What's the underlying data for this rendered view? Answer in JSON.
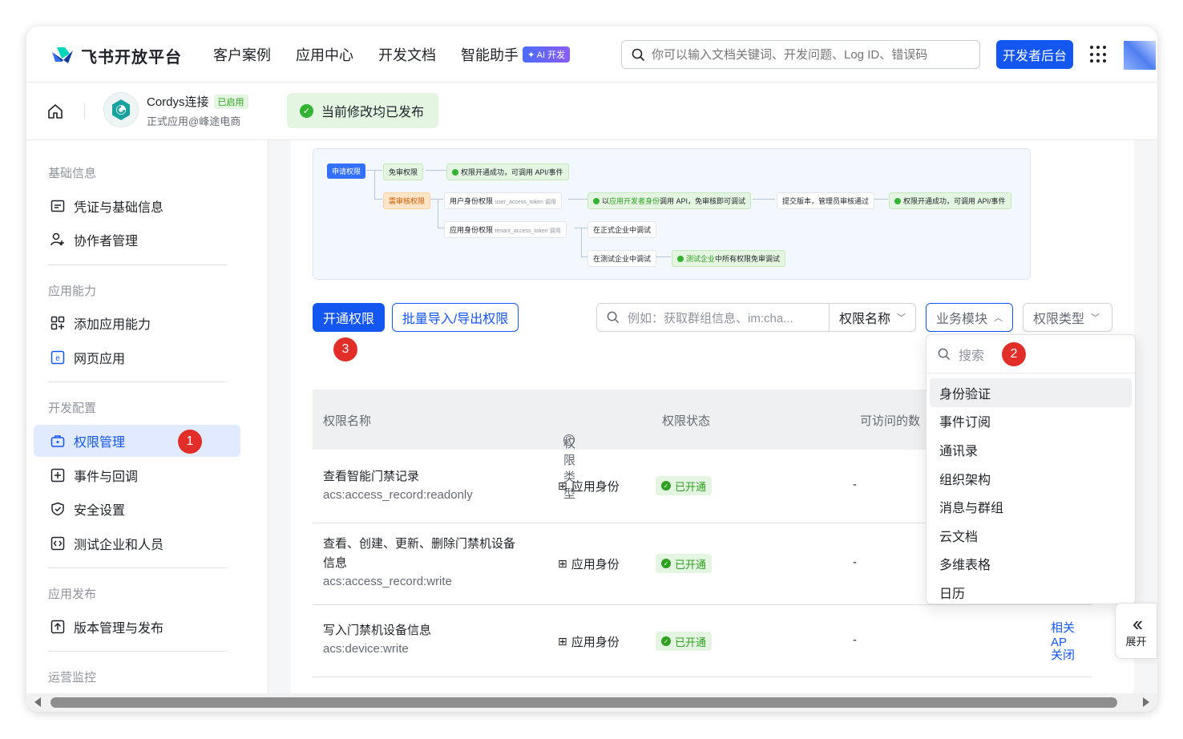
{
  "topnav": {
    "logo_text": "飞书开放平台",
    "links": [
      "客户案例",
      "应用中心",
      "开发文档",
      "智能助手"
    ],
    "ai_badge": "✦ AI 开发",
    "search_placeholder": "你可以输入文档关键词、开发问题、Log ID、错误码",
    "dev_button": "开发者后台"
  },
  "appbar": {
    "app_name": "Cordys连接",
    "app_status": "已启用",
    "app_subtitle": "正式应用@峰途电商",
    "published_notice": "当前修改均已发布"
  },
  "sidebar": {
    "sections": [
      {
        "title": "基础信息",
        "items": [
          "凭证与基础信息",
          "协作者管理"
        ]
      },
      {
        "title": "应用能力",
        "items": [
          "添加应用能力",
          "网页应用"
        ]
      },
      {
        "title": "开发配置",
        "items": [
          "权限管理",
          "事件与回调",
          "安全设置",
          "测试企业和人员"
        ]
      },
      {
        "title": "应用发布",
        "items": [
          "版本管理与发布"
        ]
      },
      {
        "title": "运营监控",
        "items": []
      }
    ],
    "active_item": "权限管理",
    "badge_1": "1"
  },
  "flow": {
    "apply": "申请权限",
    "no_review": "免审权限",
    "success1": "权限开通成功，可调用 API/事件",
    "need_review": "需审核权限",
    "user_perm": "用户身份权限",
    "user_token": "user_access_token 调用",
    "dev_call_prefix": "以",
    "dev_call_highlight": "应用开发者身份",
    "dev_call_suffix": "调用 API，免审核即可调试",
    "submit": "提交版本，管理员审核通过",
    "success2": "权限开通成功，可调用 API/事件",
    "app_perm": "应用身份权限",
    "tenant_token": "tenant_access_token 调用",
    "prod_debug": "在正式企业中调试",
    "test_debug": "在测试企业中调试",
    "test_all_highlight": "测试企业",
    "test_all_suffix": "中所有权限免审调试"
  },
  "toolbar": {
    "open_perm": "开通权限",
    "batch": "批量导入/导出权限",
    "badge_3": "3",
    "search_placeholder": "例如：获取群组信息、im:cha...",
    "perm_name_select": "权限名称",
    "biz_module_select": "业务模块",
    "perm_type_select": "权限类型"
  },
  "table": {
    "headers": [
      "权限名称",
      "权限类型",
      "权限状态",
      "可访问的数"
    ],
    "rows": [
      {
        "name": "查看智能门禁记录",
        "key": "acs:access_record:readonly",
        "identity": "应用身份",
        "status": "已开通",
        "scope": "-"
      },
      {
        "name": "查看、创建、更新、删除门禁机设备",
        "name2": "信息",
        "key": "acs:access_record:write",
        "identity": "应用身份",
        "status": "已开通",
        "scope": "-"
      },
      {
        "name": "写入门禁机设备信息",
        "key": "acs:device:write",
        "identity": "应用身份",
        "status": "已开通",
        "scope": "-",
        "link1": "相关 AP",
        "link2": "关闭"
      }
    ]
  },
  "dropdown": {
    "search_placeholder": "搜索",
    "badge_2": "2",
    "options": [
      "身份验证",
      "事件订阅",
      "通讯录",
      "组织架构",
      "消息与群组",
      "云文档",
      "多维表格",
      "日历"
    ],
    "hovered": "身份验证"
  },
  "expand": {
    "label": "展开"
  }
}
